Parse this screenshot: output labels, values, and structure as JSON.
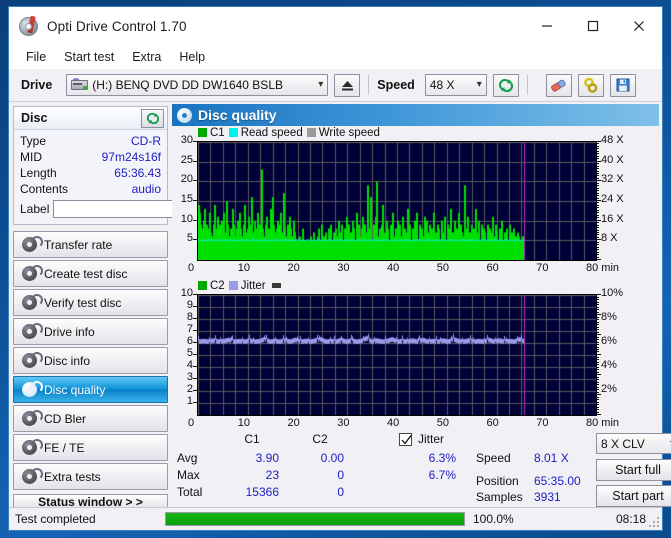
{
  "window": {
    "title": "Opti Drive Control 1.70",
    "app_icon": "disc-icon",
    "minimize": "minimize-icon",
    "maximize": "maximize-icon",
    "close": "close-icon"
  },
  "menu": [
    "File",
    "Start test",
    "Extra",
    "Help"
  ],
  "toolbar": {
    "drive_label": "Drive",
    "drive_value": "(H:)  BENQ DVD DD DW1640 BSLB",
    "eject_icon": "eject-icon",
    "speed_label": "Speed",
    "speed_value": "48 X",
    "refresh_icon": "refresh-icon",
    "eraser_icon": "eraser-icon",
    "link_icon": "chain-link-icon",
    "save_icon": "floppy-save-icon"
  },
  "disc_panel": {
    "header": "Disc",
    "refresh_icon": "refresh-icon",
    "rows": [
      {
        "key": "Type",
        "value": "CD-R"
      },
      {
        "key": "MID",
        "value": "97m24s16f"
      },
      {
        "key": "Length",
        "value": "65:36.43"
      },
      {
        "key": "Contents",
        "value": "audio"
      }
    ],
    "label_key": "Label",
    "label_value": "",
    "label_placeholder": "",
    "label_button_icon": "cd-disc-icon"
  },
  "nav": {
    "items": [
      {
        "label": "Transfer rate",
        "selected": false
      },
      {
        "label": "Create test disc",
        "selected": false
      },
      {
        "label": "Verify test disc",
        "selected": false
      },
      {
        "label": "Drive info",
        "selected": false
      },
      {
        "label": "Disc info",
        "selected": false
      },
      {
        "label": "Disc quality",
        "selected": true
      },
      {
        "label": "CD Bler",
        "selected": false
      },
      {
        "label": "FE / TE",
        "selected": false
      },
      {
        "label": "Extra tests",
        "selected": false
      }
    ],
    "status_window_button": "Status window > >"
  },
  "content": {
    "header": "Disc quality",
    "header_icon": "disc-quality-icon"
  },
  "chart_data": [
    {
      "type": "area",
      "name": "c1-chart",
      "title": "",
      "legend": [
        {
          "label": "C1",
          "color": "#00a800"
        },
        {
          "label": "Read speed",
          "color": "#00f0f0"
        },
        {
          "label": "Write speed",
          "color": "#9a9a9a"
        }
      ],
      "legend_position": "top-left",
      "xlabel": "80 min",
      "xlim": [
        0,
        80
      ],
      "xticks": [
        0,
        10,
        20,
        30,
        40,
        50,
        60,
        70,
        80
      ],
      "xticklabels": [
        "0",
        "10",
        "20",
        "30",
        "40",
        "50",
        "60",
        "70",
        "80 min"
      ],
      "ylabel": "",
      "ylim": [
        0,
        30
      ],
      "yticks": [
        5,
        10,
        15,
        20,
        25,
        30
      ],
      "yticklabels": [
        "5",
        "10",
        "15",
        "20",
        "25",
        "30"
      ],
      "y2label": "",
      "y2lim": [
        0,
        48
      ],
      "y2ticks": [
        8,
        16,
        24,
        32,
        40,
        48
      ],
      "y2ticklabels": [
        "8 X",
        "16 X",
        "24 X",
        "32 X",
        "40 X",
        "48 X"
      ],
      "grid": true,
      "plot_bg": "#000038",
      "data_end_min": 65.6,
      "marker_line_min": 65.6,
      "marker_color": "#c030c0",
      "series": [
        {
          "name": "C1",
          "color": "#00e000",
          "baseline": 5,
          "values": [
            14,
            12,
            9,
            8,
            10,
            13,
            7,
            9,
            8,
            12,
            7,
            6,
            9,
            14,
            8,
            7,
            11,
            9,
            6,
            10,
            8,
            12,
            7,
            15,
            9,
            6,
            8,
            7,
            13,
            9,
            6,
            8,
            10,
            7,
            12,
            8,
            6,
            9,
            14,
            7,
            8,
            11,
            6,
            9,
            16,
            7,
            10,
            8,
            6,
            12,
            9,
            7,
            23,
            8,
            6,
            9,
            11,
            7,
            8,
            13,
            6,
            16,
            9,
            7,
            8,
            10,
            6,
            9,
            12,
            7,
            17,
            8,
            6,
            9,
            7,
            11,
            8,
            6,
            10,
            7,
            5,
            4,
            3,
            6,
            2,
            5,
            8,
            3,
            5,
            2,
            1,
            4,
            6,
            3,
            5,
            7,
            2,
            4,
            6,
            8,
            5,
            9,
            3,
            6,
            4,
            7,
            5,
            8,
            6,
            9,
            4,
            7,
            5,
            8,
            6,
            10,
            4,
            7,
            9,
            5,
            8,
            6,
            11,
            5,
            9,
            7,
            6,
            10,
            8,
            5,
            12,
            7,
            9,
            6,
            8,
            11,
            5,
            9,
            7,
            19,
            6,
            8,
            16,
            5,
            9,
            7,
            11,
            20,
            6,
            8,
            5,
            9,
            14,
            7,
            6,
            10,
            8,
            5,
            9,
            7,
            12,
            6,
            8,
            5,
            10,
            7,
            9,
            6,
            11,
            5,
            8,
            7,
            13,
            6,
            9,
            5,
            8,
            7,
            10,
            6,
            12,
            5,
            9,
            7,
            8,
            6,
            11,
            5,
            10,
            7,
            9,
            6,
            8,
            5,
            12,
            7,
            6,
            9,
            8,
            5,
            10,
            7,
            6,
            11,
            5,
            9,
            8,
            6,
            13,
            7,
            5,
            10,
            6,
            8,
            12,
            5,
            9,
            7,
            6,
            19,
            8,
            5,
            11,
            7,
            6,
            9,
            5,
            8,
            13,
            6,
            7,
            10,
            5,
            9,
            6,
            8,
            7,
            5,
            9,
            6,
            8,
            7,
            11,
            5,
            6,
            9,
            7,
            5,
            8,
            6,
            10,
            5,
            7,
            6,
            8,
            5,
            9,
            6,
            7,
            5,
            8,
            6,
            5,
            7,
            6,
            5,
            4,
            6,
            5
          ]
        },
        {
          "name": "Read speed",
          "color": "#00f0f0",
          "constant_x": 8.0,
          "note": "flat read speed trace near 8 X (drawn at y=5 on C1 scale)"
        }
      ],
      "stats_ref": {
        "avg": 3.9,
        "max": 23,
        "total": 15366
      }
    },
    {
      "type": "line",
      "name": "c2-jitter-chart",
      "title": "",
      "legend": [
        {
          "label": "C2",
          "color": "#00a800"
        },
        {
          "label": "Jitter",
          "color": "#9a9aea"
        }
      ],
      "legend_position": "top-left",
      "xlabel": "80 min",
      "xlim": [
        0,
        80
      ],
      "xticks": [
        0,
        10,
        20,
        30,
        40,
        50,
        60,
        70,
        80
      ],
      "xticklabels": [
        "0",
        "10",
        "20",
        "30",
        "40",
        "50",
        "60",
        "70",
        "80 min"
      ],
      "ylim": [
        0,
        10
      ],
      "yticks": [
        1,
        2,
        3,
        4,
        5,
        6,
        7,
        8,
        9,
        10
      ],
      "yticklabels": [
        "1",
        "2",
        "3",
        "4",
        "5",
        "6",
        "7",
        "8",
        "9",
        "10"
      ],
      "y2lim": [
        0,
        10
      ],
      "y2ticks": [
        2,
        4,
        6,
        8,
        10
      ],
      "y2ticklabels": [
        "2%",
        "4%",
        "6%",
        "8%",
        "10%"
      ],
      "grid": true,
      "plot_bg": "#000038",
      "data_end_min": 65.6,
      "marker_line_min": 65.6,
      "marker_color": "#c030c0",
      "series": [
        {
          "name": "Jitter",
          "color": "#9a9aea",
          "avg_percent": 6.3,
          "max_percent": 6.7,
          "values": [
            6.3,
            6.35,
            6.3,
            6.4,
            6.3,
            6.35,
            6.45,
            6.3,
            6.35,
            6.3,
            6.4,
            6.3,
            6.35,
            6.5,
            6.3,
            6.35,
            6.3,
            6.4,
            6.3,
            6.45,
            6.3,
            6.35,
            6.3,
            6.4,
            6.5,
            6.3,
            6.35,
            6.3,
            6.45,
            6.3,
            6.4,
            6.3,
            6.35,
            6.6,
            6.3,
            6.4,
            6.3,
            6.35,
            6.5,
            6.3,
            6.35,
            6.3,
            6.4,
            6.3,
            6.45,
            6.3,
            6.35,
            6.3,
            6.4,
            6.3,
            6.5,
            6.35,
            6.3,
            6.4,
            6.3,
            6.35,
            6.3,
            6.45,
            6.3,
            6.4,
            6.3,
            6.35,
            6.3,
            6.5,
            6.3
          ]
        },
        {
          "name": "C2",
          "color": "#00a800",
          "values_all_zero": true
        }
      ],
      "stats_ref": {
        "c2_avg": 0.0,
        "c2_max": 0,
        "c2_total": 0
      }
    }
  ],
  "stats": {
    "columns": [
      "C1",
      "C2"
    ],
    "jitter_label": "Jitter",
    "jitter_checked": true,
    "rows": [
      {
        "label": "Avg",
        "c1": "3.90",
        "c2": "0.00",
        "jitter": "6.3%"
      },
      {
        "label": "Max",
        "c1": "23",
        "c2": "0",
        "jitter": "6.7%"
      },
      {
        "label": "Total",
        "c1": "15366",
        "c2": "0",
        "jitter": ""
      }
    ],
    "speed_label": "Speed",
    "speed_value": "8.01 X",
    "position_label": "Position",
    "position_value": "65:35.00",
    "samples_label": "Samples",
    "samples_value": "3931",
    "mode_value": "8 X CLV",
    "start_full": "Start full",
    "start_part": "Start part"
  },
  "statusbar": {
    "text": "Test completed",
    "progress_percent": 100.0,
    "progress_label": "100.0%",
    "time": "08:18"
  },
  "colors": {
    "accent": "#1a73c0",
    "plot_bg": "#000038",
    "c1_green": "#00e000",
    "read_speed": "#00f0f0",
    "jitter": "#9a9aea",
    "value_blue": "#2020c0",
    "progress_green": "#05a205",
    "marker": "#c030c0"
  }
}
